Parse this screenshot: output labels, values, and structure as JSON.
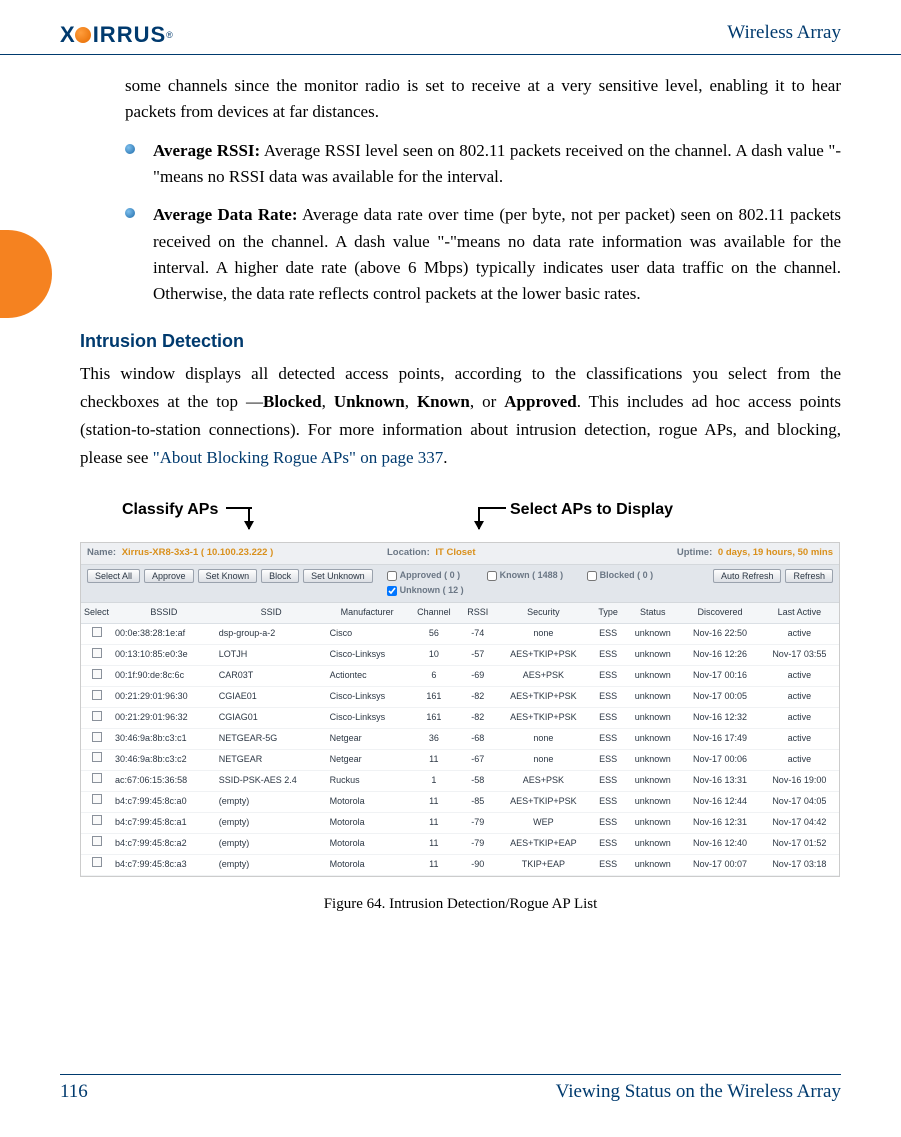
{
  "header": {
    "logo_text": "IRRUS",
    "right_text": "Wireless Array"
  },
  "intro_continuation": "some channels since the monitor radio is set to receive at a very sensitive level, enabling it to hear packets from devices at far distances.",
  "bullets": [
    {
      "term": "Average RSSI:",
      "text": " Average RSSI level seen on 802.11 packets received on the channel. A dash value \"-\"means no RSSI data was available for the interval."
    },
    {
      "term": "Average Data Rate:",
      "text": " Average data rate over time (per byte, not per packet) seen on 802.11 packets received on the channel. A dash value \"-\"means no data rate information was available for the interval. A higher date rate (above 6 Mbps) typically indicates user data traffic on the channel. Otherwise, the data rate reflects control packets at the lower basic rates."
    }
  ],
  "section_heading": "Intrusion Detection",
  "section_para_pre": "This window displays all detected access points, according to the classifications you select from the checkboxes at the top —",
  "section_para_bold": [
    "Blocked",
    "Unknown",
    "Known",
    "Approved"
  ],
  "section_para_post": ". This includes ad hoc access points (station-to-station connections). For more information about intrusion detection, rogue APs, and blocking, please see ",
  "section_xref": "\"About Blocking Rogue APs\" on page 337",
  "section_para_end": ".",
  "annotations": {
    "left": "Classify APs",
    "right": "Select APs to Display"
  },
  "screenshot": {
    "topbar": {
      "name_label": "Name:",
      "name_value": "Xirrus-XR8-3x3-1   ( 10.100.23.222 )",
      "location_label": "Location:",
      "location_value": "IT Closet",
      "uptime_label": "Uptime:",
      "uptime_value": "0 days, 19 hours, 50 mins"
    },
    "buttons": {
      "select_all": "Select All",
      "approve": "Approve",
      "set_known": "Set Known",
      "block": "Block",
      "set_unknown": "Set Unknown",
      "auto_refresh": "Auto Refresh",
      "refresh": "Refresh"
    },
    "filters": {
      "approved": "Approved ( 0 )",
      "known": "Known ( 1488 )",
      "blocked": "Blocked ( 0 )",
      "unknown": "Unknown ( 12 )"
    },
    "columns": [
      "Select",
      "BSSID",
      "SSID",
      "Manufacturer",
      "Channel",
      "RSSI",
      "Security",
      "Type",
      "Status",
      "Discovered",
      "Last Active"
    ],
    "rows": [
      [
        "00:0e:38:28:1e:af",
        "dsp-group-a-2",
        "Cisco",
        "56",
        "-74",
        "none",
        "ESS",
        "unknown",
        "Nov-16 22:50",
        "active"
      ],
      [
        "00:13:10:85:e0:3e",
        "LOTJH",
        "Cisco-Linksys",
        "10",
        "-57",
        "AES+TKIP+PSK",
        "ESS",
        "unknown",
        "Nov-16 12:26",
        "Nov-17 03:55"
      ],
      [
        "00:1f:90:de:8c:6c",
        "CAR03T",
        "Actiontec",
        "6",
        "-69",
        "AES+PSK",
        "ESS",
        "unknown",
        "Nov-17 00:16",
        "active"
      ],
      [
        "00:21:29:01:96:30",
        "CGIAE01",
        "Cisco-Linksys",
        "161",
        "-82",
        "AES+TKIP+PSK",
        "ESS",
        "unknown",
        "Nov-17 00:05",
        "active"
      ],
      [
        "00:21:29:01:96:32",
        "CGIAG01",
        "Cisco-Linksys",
        "161",
        "-82",
        "AES+TKIP+PSK",
        "ESS",
        "unknown",
        "Nov-16 12:32",
        "active"
      ],
      [
        "30:46:9a:8b:c3:c1",
        "NETGEAR-5G",
        "Netgear",
        "36",
        "-68",
        "none",
        "ESS",
        "unknown",
        "Nov-16 17:49",
        "active"
      ],
      [
        "30:46:9a:8b:c3:c2",
        "NETGEAR",
        "Netgear",
        "11",
        "-67",
        "none",
        "ESS",
        "unknown",
        "Nov-17 00:06",
        "active"
      ],
      [
        "ac:67:06:15:36:58",
        "SSID-PSK-AES 2.4",
        "Ruckus",
        "1",
        "-58",
        "AES+PSK",
        "ESS",
        "unknown",
        "Nov-16 13:31",
        "Nov-16 19:00"
      ],
      [
        "b4:c7:99:45:8c:a0",
        "(empty)",
        "Motorola",
        "11",
        "-85",
        "AES+TKIP+PSK",
        "ESS",
        "unknown",
        "Nov-16 12:44",
        "Nov-17 04:05"
      ],
      [
        "b4:c7:99:45:8c:a1",
        "(empty)",
        "Motorola",
        "11",
        "-79",
        "WEP",
        "ESS",
        "unknown",
        "Nov-16 12:31",
        "Nov-17 04:42"
      ],
      [
        "b4:c7:99:45:8c:a2",
        "(empty)",
        "Motorola",
        "11",
        "-79",
        "AES+TKIP+EAP",
        "ESS",
        "unknown",
        "Nov-16 12:40",
        "Nov-17 01:52"
      ],
      [
        "b4:c7:99:45:8c:a3",
        "(empty)",
        "Motorola",
        "11",
        "-90",
        "TKIP+EAP",
        "ESS",
        "unknown",
        "Nov-17 00:07",
        "Nov-17 03:18"
      ]
    ]
  },
  "figure_caption": "Figure 64. Intrusion Detection/Rogue AP List",
  "footer": {
    "page_number": "116",
    "section": "Viewing Status on the Wireless Array"
  }
}
